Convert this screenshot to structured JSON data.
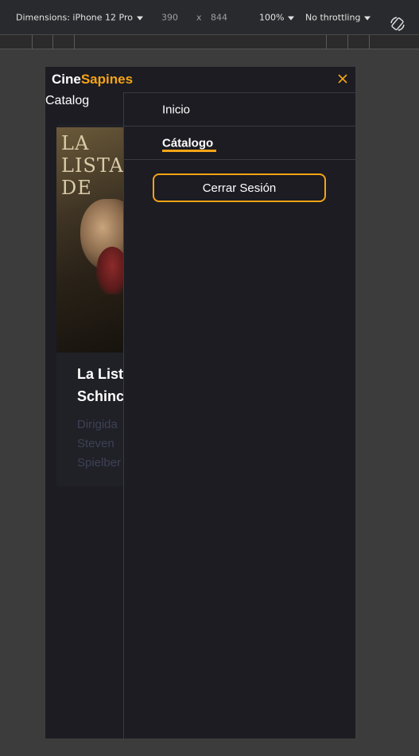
{
  "devtools": {
    "device_label": "Dimensions: iPhone 12 Pro",
    "width": "390",
    "times": "x",
    "height": "844",
    "zoom": "100%",
    "throttling": "No throttling",
    "rotate_icon": "rotate-icon"
  },
  "app": {
    "brand_part1": "Cine",
    "brand_part2": "Sapines",
    "accent_color": "#f5a416",
    "close_icon": "close-icon",
    "page_heading": "Catalog"
  },
  "card": {
    "poster_text": "LA LISTA DE",
    "title_line1": "La List",
    "title_line2": "Schinc",
    "sub_line1": "Dirigida",
    "sub_line2": "Steven",
    "sub_line3": "Spielber"
  },
  "nav": {
    "items": [
      {
        "label": "Inicio"
      },
      {
        "label": "Cátalogo"
      }
    ],
    "logout_label": "Cerrar Sesión"
  }
}
